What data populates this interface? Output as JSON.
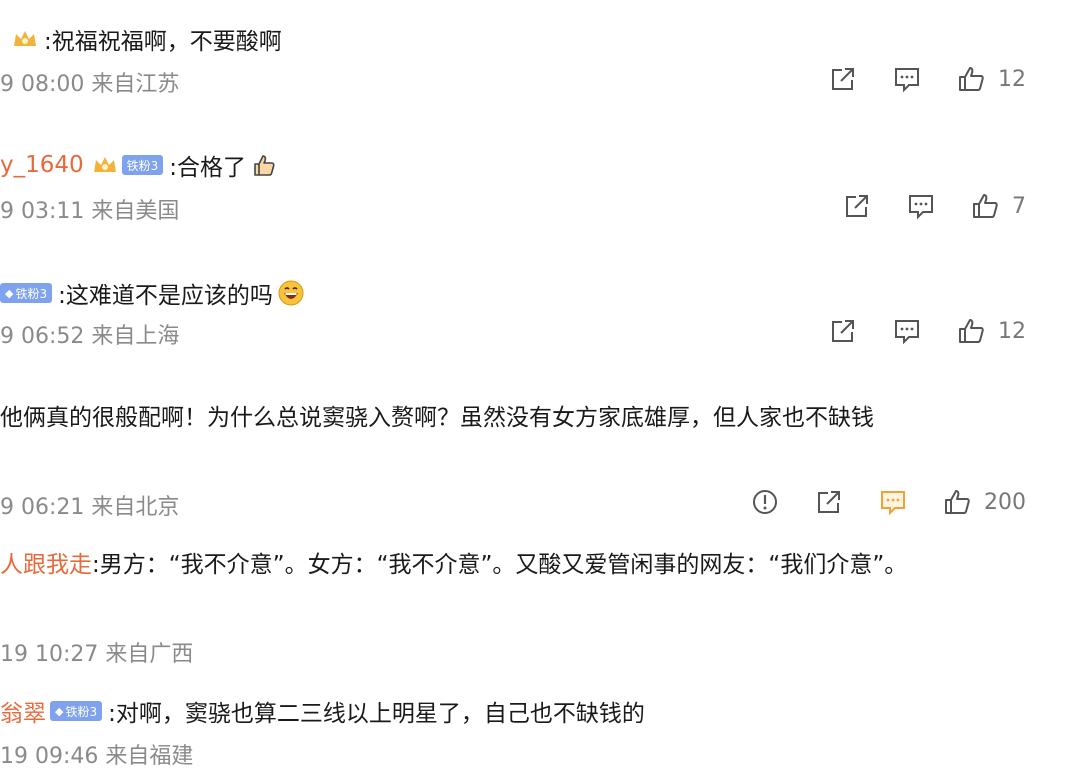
{
  "comments": [
    {
      "username": "",
      "text": ":祝福祝福啊，不要酸啊",
      "meta": "9 08:00 来自江苏",
      "likes": "12"
    },
    {
      "username": "y_1640",
      "badge": "铁粉3",
      "text": ":合格了",
      "meta": "9 03:11 来自美国",
      "likes": "7"
    },
    {
      "badge": "铁粉3",
      "text": ":这难道不是应该的吗",
      "meta": "9 06:52 来自上海",
      "likes": "12"
    },
    {
      "text": "他俩真的很般配啊！为什么总说窦骁入赘啊？虽然没有女方家底雄厚，但人家也不缺钱",
      "meta": "9 06:21 来自北京",
      "likes": "200"
    },
    {
      "username": "人跟我走",
      "text": ":男方：“我不介意”。女方：“我不介意”。又酸又爱管闲事的网友：“我们介意”。",
      "meta": "19 10:27 来自广西"
    },
    {
      "username": "翁翠",
      "badge": "铁粉3",
      "text": ":对啊，窦骁也算二三线以上明星了，自己也不缺钱的",
      "meta": "19 09:46 来自福建"
    }
  ],
  "colors": {
    "username": "#e9693b",
    "meta": "#8a8a8a",
    "icon": "#555555",
    "active_icon": "#f0a13a",
    "badge": "#7fa2ef"
  },
  "icons": [
    "share-icon",
    "comment-icon",
    "like-icon",
    "report-icon",
    "crown-icon",
    "thumbs-up-emoji",
    "grin-emoji"
  ]
}
